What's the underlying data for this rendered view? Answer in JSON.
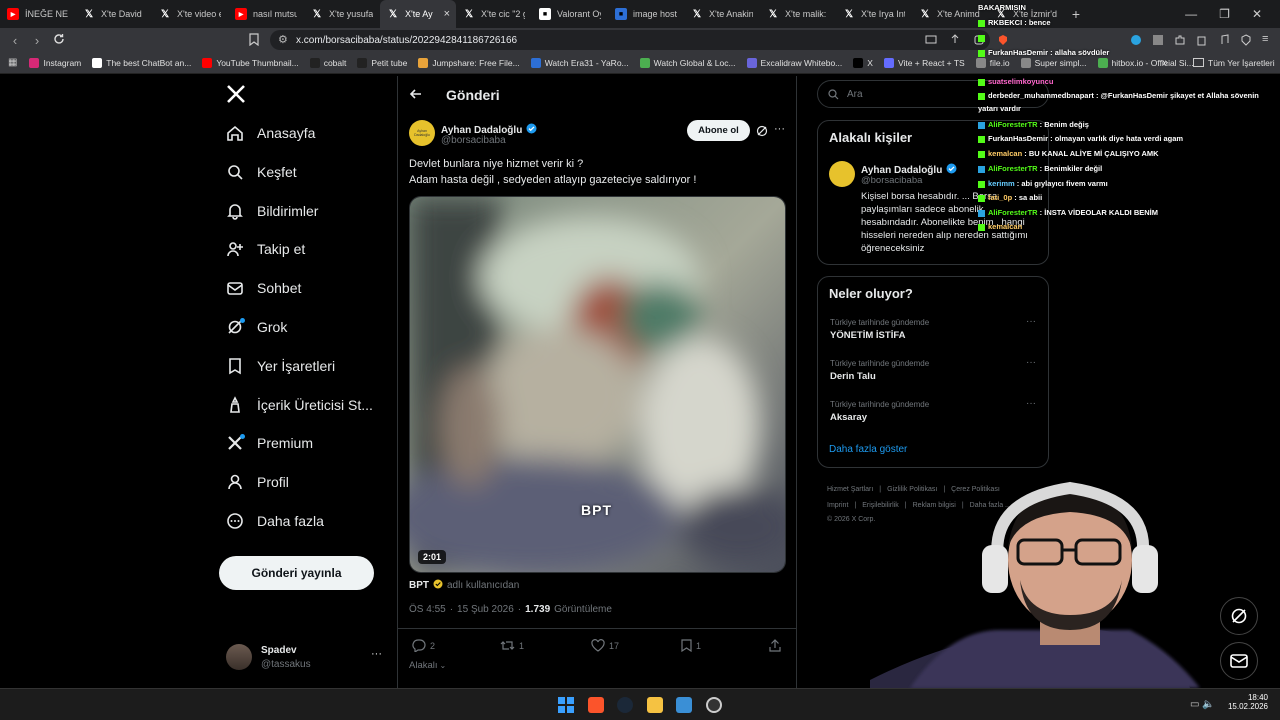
{
  "browser": {
    "tabs": [
      {
        "title": "İNEĞE NE S",
        "icon": "youtube-icon",
        "color": "#ff0000"
      },
      {
        "title": "X'te David",
        "icon": "x-icon",
        "color": "#ffffff"
      },
      {
        "title": "X'te video e",
        "icon": "x-icon",
        "color": "#ffffff"
      },
      {
        "title": "nasıl mutsuz",
        "icon": "youtube-icon",
        "color": "#ff0000"
      },
      {
        "title": "X'te yusufal",
        "icon": "x-icon",
        "color": "#ffffff"
      },
      {
        "title": "X'te Ay",
        "icon": "x-icon",
        "color": "#ffffff",
        "active": true
      },
      {
        "title": "X'te cic \"2 g",
        "icon": "x-icon",
        "color": "#ffffff"
      },
      {
        "title": "Valorant Oy",
        "icon": "tiktok-icon",
        "color": "#ffffff"
      },
      {
        "title": "image hosti",
        "icon": "imagehost-icon",
        "color": "#2d6fd6"
      },
      {
        "title": "X'te Anakin",
        "icon": "x-icon",
        "color": "#ffffff"
      },
      {
        "title": "X'te malik:",
        "icon": "x-icon",
        "color": "#ffffff"
      },
      {
        "title": "X'te Irya Inte",
        "icon": "x-icon",
        "color": "#ffffff"
      },
      {
        "title": "X'te Animd",
        "icon": "x-icon",
        "color": "#ffffff"
      },
      {
        "title": "X'te İzmir'd",
        "icon": "x-icon",
        "color": "#ffffff"
      }
    ],
    "new_tab": "+",
    "url": "x.com/borsacibaba/status/2022942841186726166",
    "bookmarks": [
      {
        "label": "Instagram",
        "icon": "instagram-icon",
        "color": "#d62976"
      },
      {
        "label": "The best ChatBot an...",
        "icon": "chatbot-icon",
        "color": "#ffffff"
      },
      {
        "label": "YouTube Thumbnail...",
        "icon": "youtube-icon",
        "color": "#ff0000"
      },
      {
        "label": "cobalt",
        "icon": "cobalt-icon",
        "color": "#222222"
      },
      {
        "label": "Petit tube",
        "icon": "petit-icon",
        "color": "#222222"
      },
      {
        "label": "Jumpshare: Free File...",
        "icon": "jumpshare-icon",
        "color": "#e8a33a"
      },
      {
        "label": "Watch Era31 - YaRo...",
        "icon": "watch-icon",
        "color": "#2d6fd6"
      },
      {
        "label": "Watch Global & Loc...",
        "icon": "watch2-icon",
        "color": "#4caf50"
      },
      {
        "label": "Excalidraw Whitebo...",
        "icon": "excalidraw-icon",
        "color": "#6965db"
      },
      {
        "label": "X",
        "icon": "x-icon",
        "color": "#000000"
      },
      {
        "label": "Vite + React + TS",
        "icon": "vite-icon",
        "color": "#646cff"
      },
      {
        "label": "file.io",
        "icon": "fileio-icon",
        "color": "#888888"
      },
      {
        "label": "Super simpl...",
        "icon": "super-icon",
        "color": "#888888"
      },
      {
        "label": "hitbox.io - Official Si...",
        "icon": "hitbox-icon",
        "color": "#4caf50"
      }
    ],
    "bookmarks_more": "»",
    "all_bookmarks": "Tüm Yer İşaretleri"
  },
  "sidebar": {
    "items": [
      {
        "label": "Anasayfa",
        "icon": "home-icon"
      },
      {
        "label": "Keşfet",
        "icon": "search-icon"
      },
      {
        "label": "Bildirimler",
        "icon": "bell-icon"
      },
      {
        "label": "Takip et",
        "icon": "add-person-icon"
      },
      {
        "label": "Sohbet",
        "icon": "mail-icon"
      },
      {
        "label": "Grok",
        "icon": "grok-icon"
      },
      {
        "label": "Yer İşaretleri",
        "icon": "bookmark-icon"
      },
      {
        "label": "İçerik Üreticisi St...",
        "icon": "creator-icon"
      },
      {
        "label": "Premium",
        "icon": "x-premium-icon"
      },
      {
        "label": "Profil",
        "icon": "person-icon"
      },
      {
        "label": "Daha fazla",
        "icon": "more-circle-icon"
      }
    ],
    "post_button": "Gönderi yayınla",
    "account": {
      "name": "Spadev",
      "handle": "@tassakus",
      "more": "···"
    }
  },
  "post": {
    "header": "Gönderi",
    "author": {
      "name": "Ayhan Dadaloğlu",
      "handle": "@borsacibaba",
      "avatar_text": "Ayhan Dadaloğlu"
    },
    "follow_button": "Abone ol",
    "text_line1": "Devlet bunlara niye hizmet verir ki ?",
    "text_line2": "Adam hasta değil , sedyeden atlayıp gazeteciye saldırıyor !",
    "video_duration": "2:01",
    "video_watermark": "BPT",
    "source_name": "BPT",
    "source_label": "adlı kullanıcıdan",
    "time": "ÖS 4:55",
    "date": "15 Şub 2026",
    "views_count": "1.739",
    "views_label": "Görüntüleme",
    "replies": "2",
    "reposts": "1",
    "likes": "17",
    "bookmarks": "1",
    "related": "Alakalı"
  },
  "right": {
    "search_placeholder": "Ara",
    "related_title": "Alakalı kişiler",
    "related_person": {
      "name": "Ayhan Dadaloğlu",
      "handle": "@borsacibaba",
      "bio": "Kişisel borsa hesabıdır. ... Borsa paylaşımları sadece abonelik hesabındadır. Abonelikte benim , hangi hisseleri nereden alıp nereden sattığımı öğreneceksiniz"
    },
    "trends_title": "Neler oluyor?",
    "trends": [
      {
        "meta": "Türkiye tarihinde gündemde",
        "name": "YÖNETİM İSTİFA"
      },
      {
        "meta": "Türkiye tarihinde gündemde",
        "name": "Derin Talu"
      },
      {
        "meta": "Türkiye tarihinde gündemde",
        "name": "Aksaray"
      }
    ],
    "show_more": "Daha fazla göster",
    "footer_row1": [
      "Hizmet Şartları",
      "Gizlilik Politikası",
      "Çerez Politikası"
    ],
    "footer_row2": [
      "Imprint",
      "Erişilebilirlik",
      "Reklam bilgisi",
      "Daha fazla ..."
    ],
    "copyright": "© 2026 X Corp."
  },
  "chat": [
    {
      "user": "BAKARMISIN",
      "msg": "",
      "color": "#ffffff"
    },
    {
      "user": "RKBEKCI",
      "msg": "bence",
      "color": "#ffffff"
    },
    {
      "user": "",
      "msg": "",
      "color": "#ff4040"
    },
    {
      "user": "FurkanHasDemir",
      "msg": "allaha sövdüler",
      "color": "#ffffff"
    },
    {
      "user": "suatselimkoyuncu",
      "msg": "",
      "color": "#ff66cc"
    },
    {
      "user": "derbeder_muhammedbnapart",
      "msg": "@FurkanHasDemir şikayet et Allaha sövenin yatarı vardır",
      "color": "#ffffff"
    },
    {
      "user": "AliForesterTR",
      "msg": "Benim değiş",
      "color": "#53fc18"
    },
    {
      "user": "FurkanHasDemir",
      "msg": "olmayan varlık diye hata verdi agam",
      "color": "#ffffff"
    },
    {
      "user": "kemalcan",
      "msg": "BU KANAL ALİYE Mİ ÇALIŞIYO AMK",
      "color": "#ffcc66"
    },
    {
      "user": "AliForesterTR",
      "msg": "Benimkiler değil",
      "color": "#53fc18"
    },
    {
      "user": "kerimm",
      "msg": "abi gıylayıcı fivem varmı",
      "color": "#66ccff"
    },
    {
      "user": "fati_0p",
      "msg": "sa abii",
      "color": "#ffcc66"
    },
    {
      "user": "AliForesterTR",
      "msg": "İNSTA VİDEOLAR KALDI BENİM",
      "color": "#53fc18"
    },
    {
      "user": "kemalcan",
      "msg": "",
      "color": "#ffcc66"
    }
  ],
  "taskbar": {
    "time": "18:40",
    "date": "15.02.2026"
  }
}
